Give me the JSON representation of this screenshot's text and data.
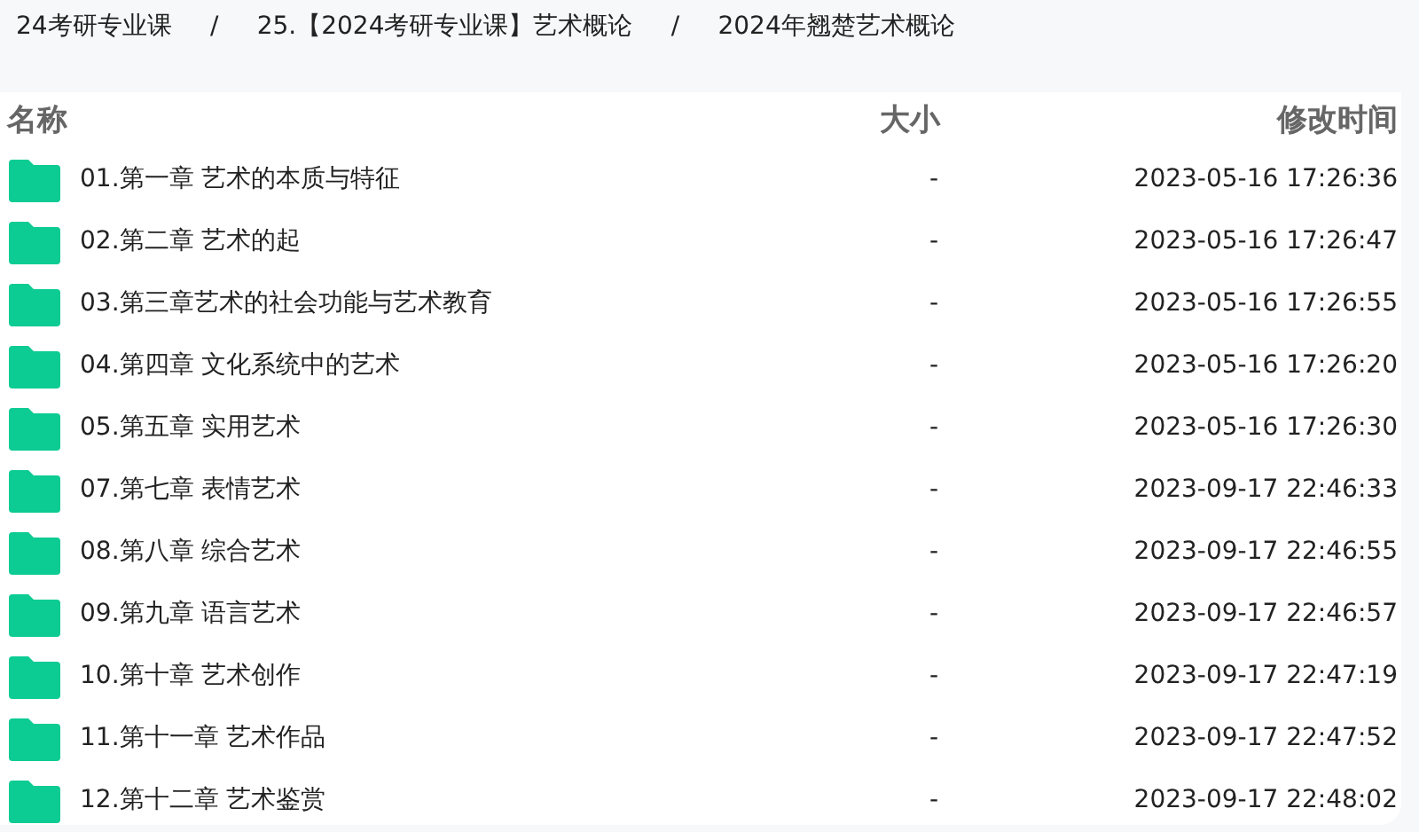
{
  "breadcrumb": [
    "24考研专业课",
    "25.【2024考研专业课】艺术概论",
    "2024年翘楚艺术概论"
  ],
  "breadcrumb_separators": [
    "/",
    "/"
  ],
  "table": {
    "columns": [
      "名称",
      "大小",
      "修改时间"
    ],
    "rows": [
      {
        "name": "01.第一章 艺术的本质与特征",
        "size": "-",
        "modified": "2023-05-16 17:26:36"
      },
      {
        "name": "02.第二章 艺术的起",
        "size": "-",
        "modified": "2023-05-16 17:26:47"
      },
      {
        "name": "03.第三章艺术的社会功能与艺术教育",
        "size": "-",
        "modified": "2023-05-16 17:26:55"
      },
      {
        "name": "04.第四章 文化系统中的艺术",
        "size": "-",
        "modified": "2023-05-16 17:26:20"
      },
      {
        "name": "05.第五章 实用艺术",
        "size": "-",
        "modified": "2023-05-16 17:26:30"
      },
      {
        "name": "07.第七章 表情艺术",
        "size": "-",
        "modified": "2023-09-17 22:46:33"
      },
      {
        "name": "08.第八章 综合艺术",
        "size": "-",
        "modified": "2023-09-17 22:46:55"
      },
      {
        "name": "09.第九章 语言艺术",
        "size": "-",
        "modified": "2023-09-17 22:46:57"
      },
      {
        "name": "10.第十章 艺术创作",
        "size": "-",
        "modified": "2023-09-17 22:47:19"
      },
      {
        "name": "11.第十一章 艺术作品",
        "size": "-",
        "modified": "2023-09-17 22:47:52"
      },
      {
        "name": "12.第十二章 艺术鉴赏",
        "size": "-",
        "modified": "2023-09-17 22:48:02"
      }
    ]
  }
}
